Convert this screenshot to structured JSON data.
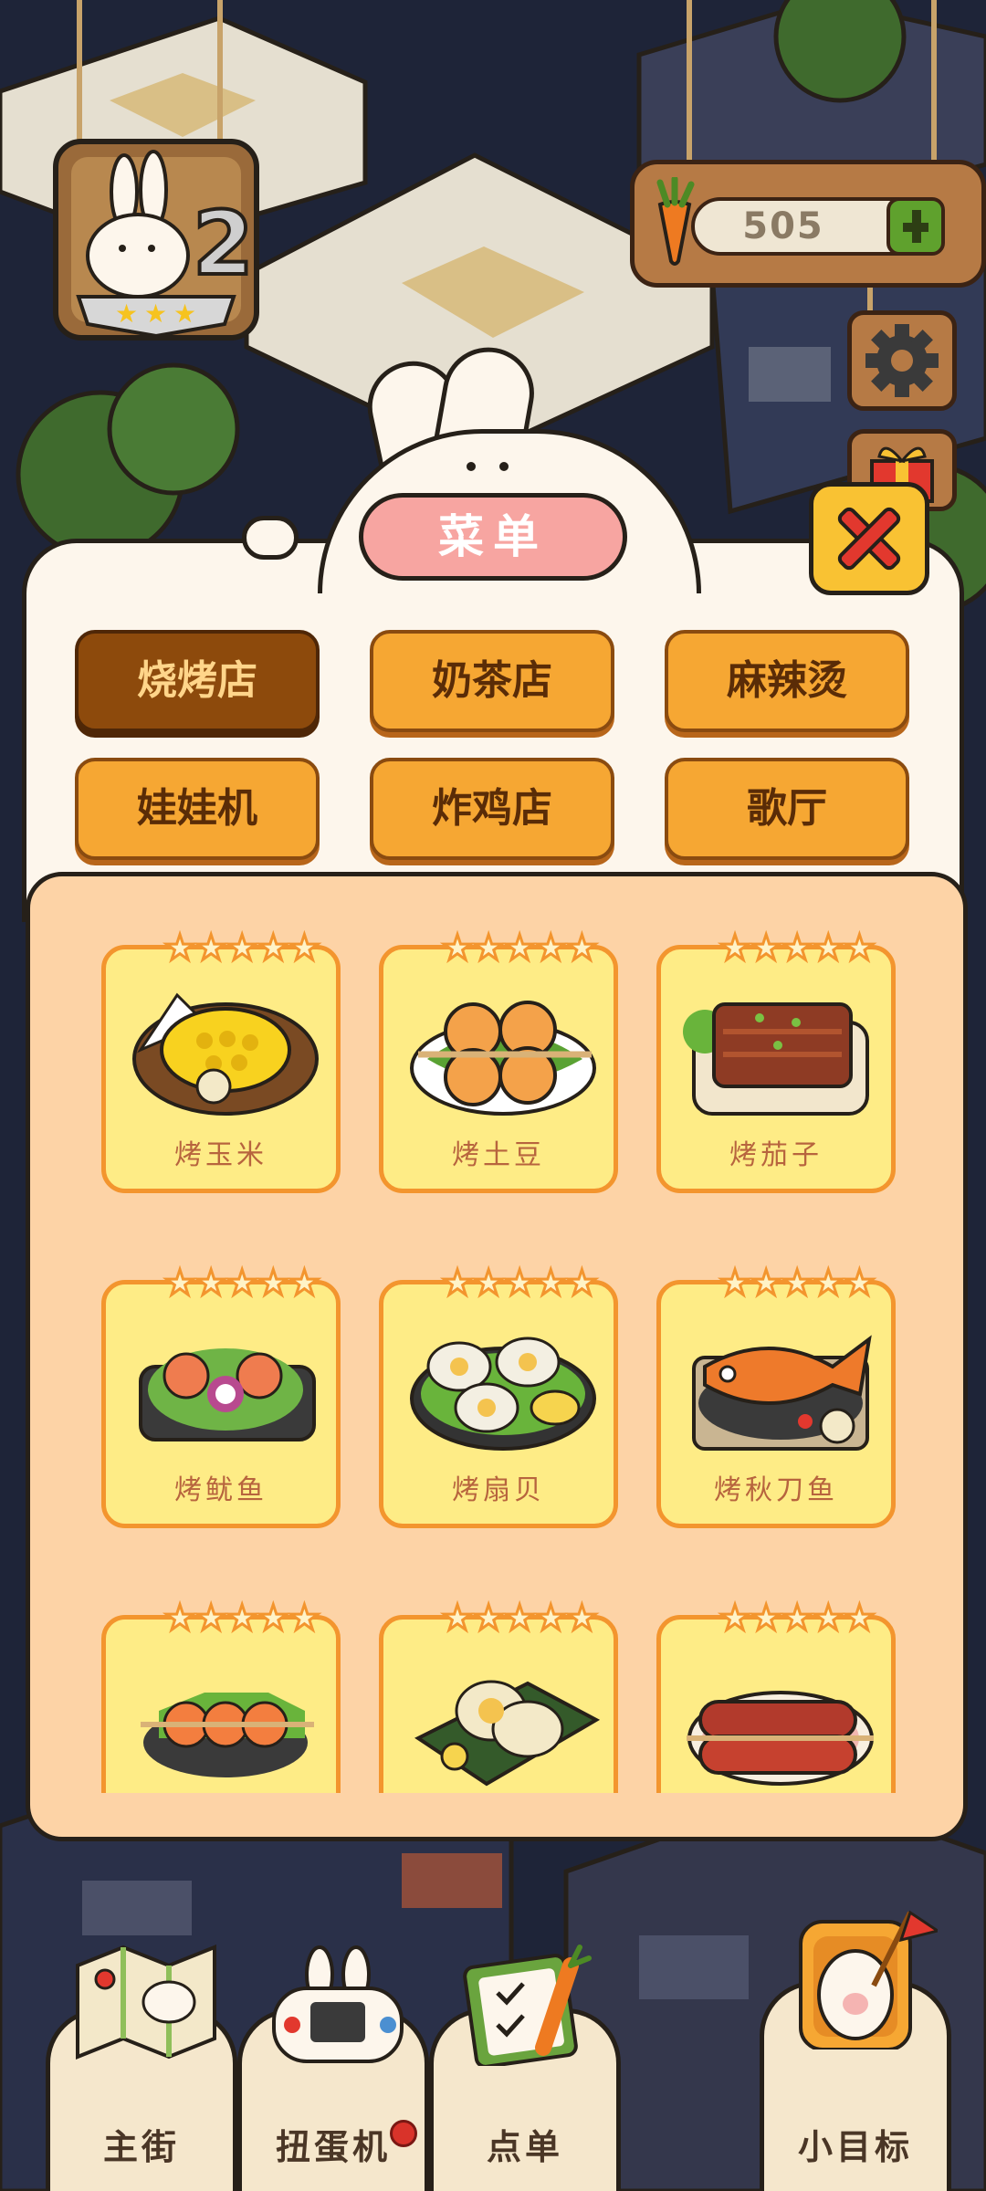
{
  "currency": {
    "carrots": "505"
  },
  "menu": {
    "title": "菜单",
    "tabs": [
      {
        "label": "烧烤店",
        "active": true
      },
      {
        "label": "奶茶店",
        "active": false
      },
      {
        "label": "麻辣烫",
        "active": false
      },
      {
        "label": "娃娃机",
        "active": false
      },
      {
        "label": "炸鸡店",
        "active": false
      },
      {
        "label": "歌厅",
        "active": false
      }
    ],
    "items": [
      {
        "name": "烤玉米",
        "stars": 5,
        "icon": "grilled-corn"
      },
      {
        "name": "烤土豆",
        "stars": 5,
        "icon": "grilled-potato"
      },
      {
        "name": "烤茄子",
        "stars": 5,
        "icon": "grilled-eggplant"
      },
      {
        "name": "烤鱿鱼",
        "stars": 5,
        "icon": "grilled-squid"
      },
      {
        "name": "烤扇贝",
        "stars": 5,
        "icon": "grilled-scallop"
      },
      {
        "name": "烤秋刀鱼",
        "stars": 5,
        "icon": "grilled-saury"
      },
      {
        "name": "",
        "stars": 5,
        "icon": "grilled-shrimp"
      },
      {
        "name": "",
        "stars": 5,
        "icon": "grilled-egg"
      },
      {
        "name": "",
        "stars": 5,
        "icon": "grilled-sausage"
      }
    ]
  },
  "bottom_nav": [
    {
      "label": "主街",
      "icon": "map-icon"
    },
    {
      "label": "扭蛋机",
      "icon": "game-console-icon"
    },
    {
      "label": "点单",
      "icon": "clipboard-icon"
    },
    {
      "label": "小目标",
      "icon": "flag-icon"
    }
  ],
  "colors": {
    "tab_active": "#8d4a0c",
    "tab_inactive": "#f6a733",
    "card_bg": "#feec86",
    "card_border": "#f3952e",
    "panel_bg": "#fdd3a6",
    "title_pill": "#f7a5a1",
    "close_bg": "#f9c233",
    "close_x": "#e2382e"
  }
}
